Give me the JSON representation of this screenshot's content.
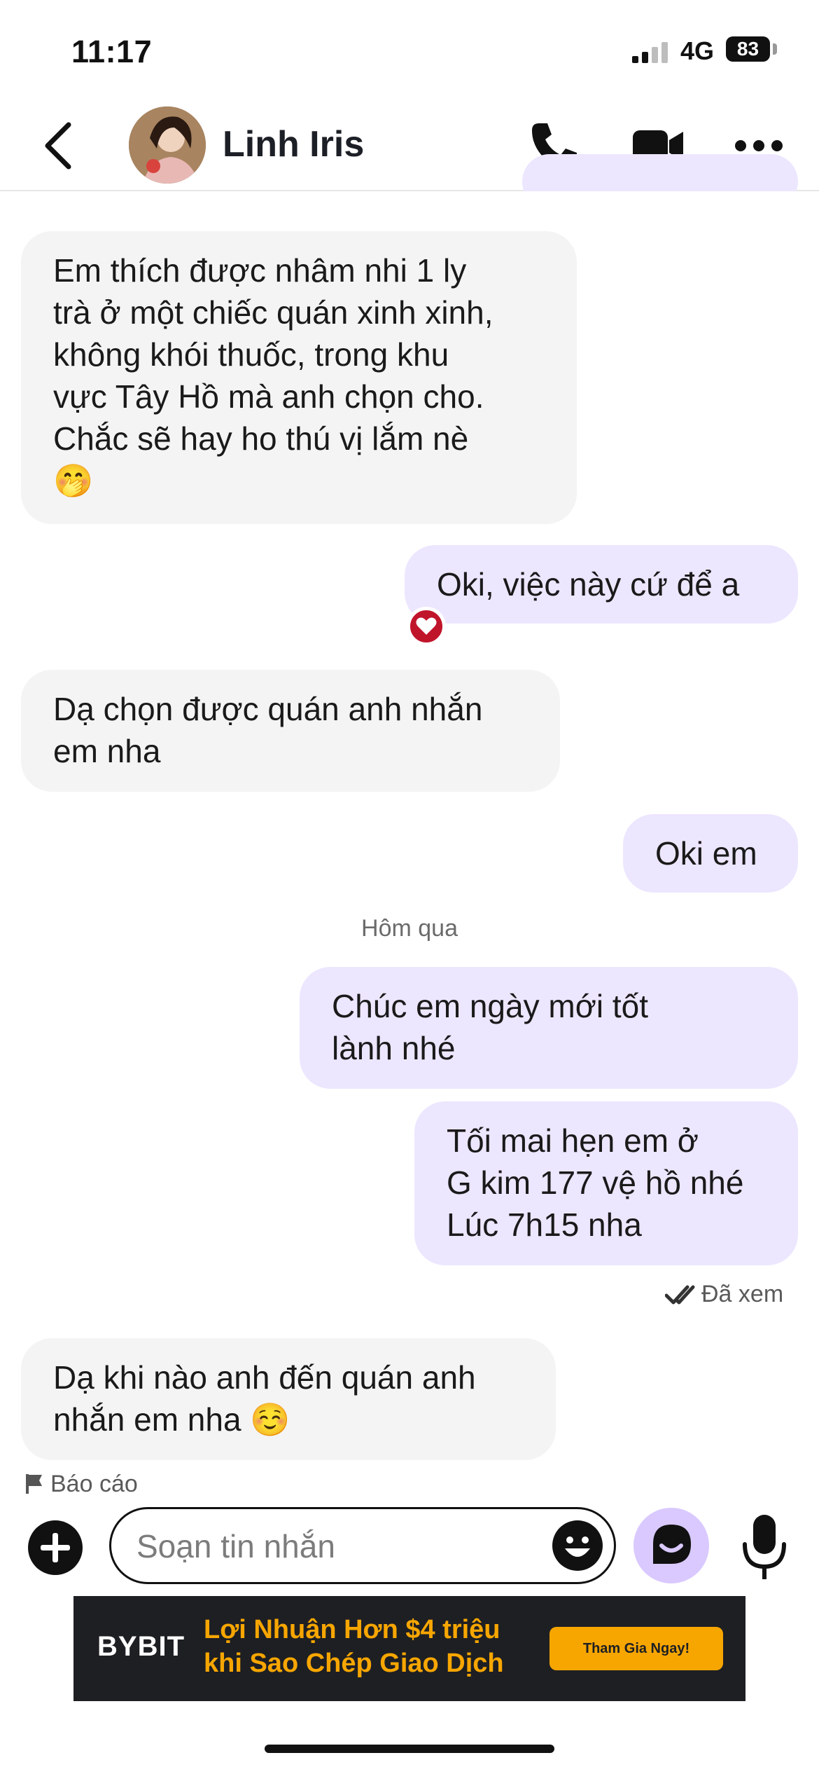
{
  "status_bar": {
    "time": "11:17",
    "network": "4G",
    "battery": "83"
  },
  "header": {
    "contact_name": "Linh Iris"
  },
  "messages": [
    {
      "from": "them",
      "lines": [
        "Em thích được nhâm nhi 1 ly",
        "trà ở một chiếc quán xinh xinh,",
        "không khói thuốc, trong khu",
        "vực Tây Hồ mà anh chọn cho.",
        "Chắc sẽ hay ho thú vị lắm nè",
        "🤭"
      ]
    },
    {
      "from": "me",
      "lines": [
        "Oki, việc này cứ để a"
      ],
      "reaction": "heart"
    },
    {
      "from": "them",
      "lines": [
        "Dạ chọn được quán anh nhắn",
        "em nha"
      ]
    },
    {
      "from": "me",
      "lines": [
        "Oki em"
      ]
    },
    {
      "from": "me",
      "lines": [
        "Chúc em ngày mới tốt",
        "lành nhé"
      ]
    },
    {
      "from": "me",
      "lines": [
        "Tối mai hẹn em ở",
        "G kim 177 vệ hồ nhé",
        "Lúc 7h15 nha"
      ]
    },
    {
      "from": "them",
      "lines": [
        "Dạ khi nào anh đến quán anh",
        "nhắn em nha ☺️"
      ]
    }
  ],
  "day_separator": "Hôm qua",
  "seen_status": "Đã xem",
  "report_label": "Báo cáo",
  "composer": {
    "placeholder": "Soạn tin nhắn"
  },
  "ad": {
    "brand": "BYBIT",
    "line1": "Lợi Nhuận Hơn $4 triệu",
    "line2": "khi Sao Chép Giao Dịch",
    "cta": "Tham Gia Ngay!"
  },
  "colors": {
    "incoming_bubble": "#f4f4f4",
    "outgoing_bubble": "#ede6ff",
    "reaction": "#c0142b",
    "accent": "#d9c9ff",
    "ad_accent": "#f7a600"
  },
  "icons": [
    "back-icon",
    "phone-icon",
    "video-icon",
    "more-icon",
    "heart-icon",
    "double-check-icon",
    "flag-icon",
    "plus-icon",
    "emoji-icon",
    "sticker-icon",
    "mic-icon"
  ]
}
